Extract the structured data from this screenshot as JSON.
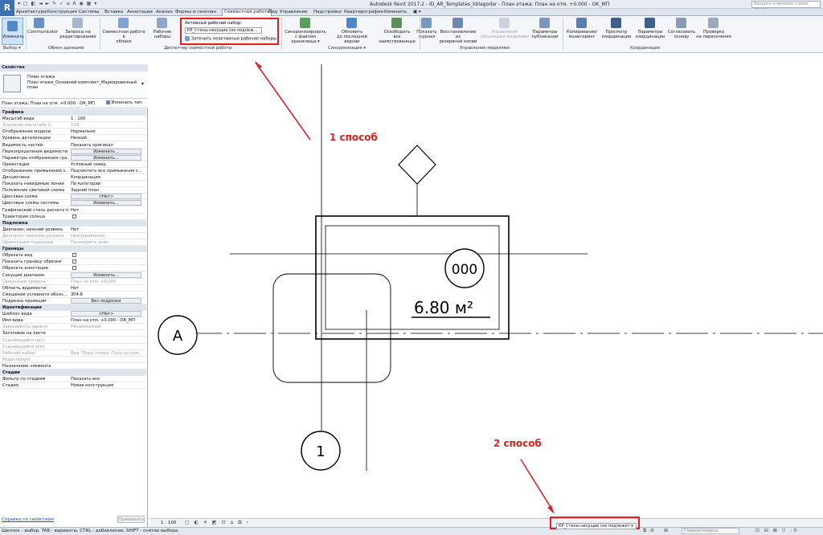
{
  "window": {
    "logo": "R",
    "title": "Autodesk Revit 2017.2 -    ID_AR_Templates_kblagodar - План этажа: План на отм. +0.000 - ОК_МП",
    "search_placeholder": "Введите ключевое слово/фразу",
    "qat": "▾ □ ◧ ◄ ► ✎ ✓ ⌀ A ◉ ▦ ▾"
  },
  "tabs": [
    "Архитектура",
    "Конструкция",
    "Системы",
    "Вставка",
    "Аннотации",
    "Анализ",
    "Формы и генплан",
    "Совместная работа",
    "Вид",
    "Управление",
    "Надстройки",
    "Квартирография",
    "Изменить",
    "▣ ▾"
  ],
  "active_tab_index": 7,
  "ribbon": {
    "select_label": "Изменить",
    "select_dropdown": "Выбор ▾",
    "buttons": {
      "communicator": "Communicator",
      "requests": "Запросы на\nредактирование",
      "collab_cloud": "Совместная работа в\nоблаке",
      "worksets": "Рабочие наборы",
      "sync": "Синхронизировать\nс файлом хранилища ▾",
      "reload": "Обновить\nдо последней версии",
      "relinquish": "Освободить\nвсе заимствованные",
      "show_history": "Показать\nжурнал",
      "restore": "Восстановление из\nрезервной копии",
      "cloud_models": "Управление\nоблачными моделями",
      "publish": "Параметры\nпубликации",
      "copy_monitor": "Копирование/\nмониторинг",
      "coord_review": "Просмотр\nкоординации",
      "coord_settings": "Параметры\nкоординации",
      "reconcile": "Согласовать\nоснову",
      "interference": "Проверка\nна пересечения"
    },
    "active_workset_label": "Активный рабочий набор:",
    "active_workset_value": "КР_Стены несущие (не подлеж...",
    "gray_inactive": "Затенить неактивные рабочие наборы",
    "panels": {
      "selection": "Выбор ▾",
      "communicate": "Обмен данными",
      "manage_collab": "Диспетчер совместной работы",
      "synchronize": "Синхронизация ▾",
      "manage_models": "Управление моделями",
      "coordinate": "Координация"
    }
  },
  "properties": {
    "header": "Свойства",
    "type_name": "План этажа",
    "type_sub": "План этажа_Основной комплект_Маркировочный план",
    "instance_label": "План этажа: План на отм. +0.000 - ОК_МП",
    "edit_type": "Изменить тип",
    "rows": [
      {
        "k": "Графика",
        "hdr": true
      },
      {
        "k": "Масштаб вида",
        "v": "1 : 100"
      },
      {
        "k": "Значение масштаба    1:",
        "v": "100",
        "grey": true
      },
      {
        "k": "Отображение модели",
        "v": "Нормально"
      },
      {
        "k": "Уровень детализации",
        "v": "Низкий"
      },
      {
        "k": "Видимость частей",
        "v": "Показать оригинал"
      },
      {
        "k": "Переопределения видимости...",
        "btn": "Изменить..."
      },
      {
        "k": "Параметры отображения гра...",
        "btn": "Изменить..."
      },
      {
        "k": "Ориентация",
        "v": "Условный север"
      },
      {
        "k": "Отображение примыканий с...",
        "v": "Подчистить все примыкания с..."
      },
      {
        "k": "Дисциплина",
        "v": "Координация"
      },
      {
        "k": "Показать невидимые линии",
        "v": "По категории"
      },
      {
        "k": "Положение цветовой схемы",
        "v": "Задний план"
      },
      {
        "k": "Цветовая схема",
        "btn": "<Нет>"
      },
      {
        "k": "Цветовые схемы системы",
        "btn": "Изменить..."
      },
      {
        "k": "Графический стиль расчета п...",
        "v": "Нет"
      },
      {
        "k": "Траектория солнца",
        "chk": true
      },
      {
        "k": "Подложка",
        "hdr": true
      },
      {
        "k": "Диапазон: нижний уровень",
        "v": "Нет"
      },
      {
        "k": "Диапазон: верхний уровень",
        "v": "Неограниченно",
        "grey": true
      },
      {
        "k": "Ориентация подложки",
        "v": "Посмотреть вниз",
        "grey": true
      },
      {
        "k": "Границы",
        "hdr": true
      },
      {
        "k": "Обрезать вид",
        "chk": true
      },
      {
        "k": "Показать границу обрезки",
        "chk": true
      },
      {
        "k": "Обрезать аннотации",
        "chk": true
      },
      {
        "k": "Секущий диапазон",
        "btn": "Изменить..."
      },
      {
        "k": "Связанный уровень",
        "v": "План на отм. +0.000",
        "grey": true
      },
      {
        "k": "Область видимости",
        "v": "Нет"
      },
      {
        "k": "Смещение условного обозн...",
        "v": "304.8"
      },
      {
        "k": "Подрезка проекции",
        "btn": "Без подрезки"
      },
      {
        "k": "Идентификация",
        "hdr": true
      },
      {
        "k": "Шаблон вида",
        "btn": "<Нет>"
      },
      {
        "k": "Имя вида",
        "v": "План на отм. +0.000 - ОК_МП"
      },
      {
        "k": "Зависимость уровня",
        "v": "Независимый",
        "grey": true
      },
      {
        "k": "Заголовок на листе",
        "v": ""
      },
      {
        "k": "Ссылающийся лист",
        "v": "",
        "grey": true
      },
      {
        "k": "Ссылающийся узел",
        "v": "",
        "grey": true
      },
      {
        "k": "Рабочий набор",
        "v": "Вид \"План этажа: План на отм...",
        "grey": true
      },
      {
        "k": "Редактирует",
        "v": "",
        "grey": true
      },
      {
        "k": "Назначение элемента",
        "v": ""
      },
      {
        "k": "Стадии",
        "hdr": true
      },
      {
        "k": "Фильтр по стадиям",
        "v": "Показать все"
      },
      {
        "k": "Стадия",
        "v": "Новая конструкция"
      }
    ],
    "help_link": "Справка по свойствам",
    "apply": "Применить"
  },
  "canvas": {
    "grid_a": "A",
    "grid_1": "1",
    "room_number": "000",
    "room_area": "6.80 м²"
  },
  "annotations": {
    "way1": "1 способ",
    "way2": "2 способ"
  },
  "view_control": {
    "scale": "1 : 100"
  },
  "status": {
    "hint": "Щелчок - выбор, TAB - варианты, CTRL - добавление, SHIFT - снятие выбора.",
    "workset": "КР_Стены несущие (не подлежит ▾",
    "zero": ":0",
    "main_model": "Главная модель"
  },
  "colors": {
    "annotation_red": "#e02020",
    "ribbon_bg": "#f4f6f9",
    "active_tab_text": "#103060"
  }
}
